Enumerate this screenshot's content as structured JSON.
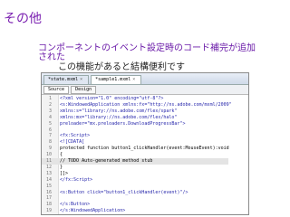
{
  "slide_title": "その他",
  "description_line1": "コンポーネントのイベント設定時のコード補完が追加",
  "description_line2": "された",
  "sub_caption": "この機能があると結構便利です",
  "editor": {
    "tabs": [
      {
        "label": "*state.mxml",
        "close": "×"
      },
      {
        "label": "*sample1.mxml",
        "close": "×"
      }
    ],
    "view_buttons": [
      "Source",
      "Design"
    ],
    "lines": [
      {
        "n": "1",
        "t": "<?xml version=\"1.0\" encoding=\"utf-8\"?>"
      },
      {
        "n": "2",
        "t": "<s:WindowedApplication xmlns:fx=\"http://ns.adobe.com/mxml/2009\""
      },
      {
        "n": "3",
        "t": "                       xmlns:s=\"library://ns.adobe.com/flex/spark\""
      },
      {
        "n": "4",
        "t": "                       xmlns:mx=\"library://ns.adobe.com/flex/halo\""
      },
      {
        "n": "5",
        "t": "                       preloader=\"mx.preloaders.DownloadProgressBar\">"
      },
      {
        "n": "6",
        "t": ""
      },
      {
        "n": "7",
        "t": "    <fx:Script>"
      },
      {
        "n": "8",
        "t": "        <![CDATA["
      },
      {
        "n": "9",
        "t": "            protected function button1_clickHandler(event:MouseEvent):void"
      },
      {
        "n": "10",
        "t": "            {"
      },
      {
        "n": "11",
        "t": "                // TODO Auto-generated method stub"
      },
      {
        "n": "12",
        "t": "            }"
      },
      {
        "n": "13",
        "t": "        ]]>"
      },
      {
        "n": "14",
        "t": "    </fx:Script>"
      },
      {
        "n": "15",
        "t": ""
      },
      {
        "n": "16",
        "t": "    <s:Button click=\"button1_clickHandler(event)\"/>"
      },
      {
        "n": "17",
        "t": ""
      },
      {
        "n": "18",
        "t": "    </s:Button>"
      },
      {
        "n": "19",
        "t": "</s:WindowedApplication>"
      }
    ]
  }
}
